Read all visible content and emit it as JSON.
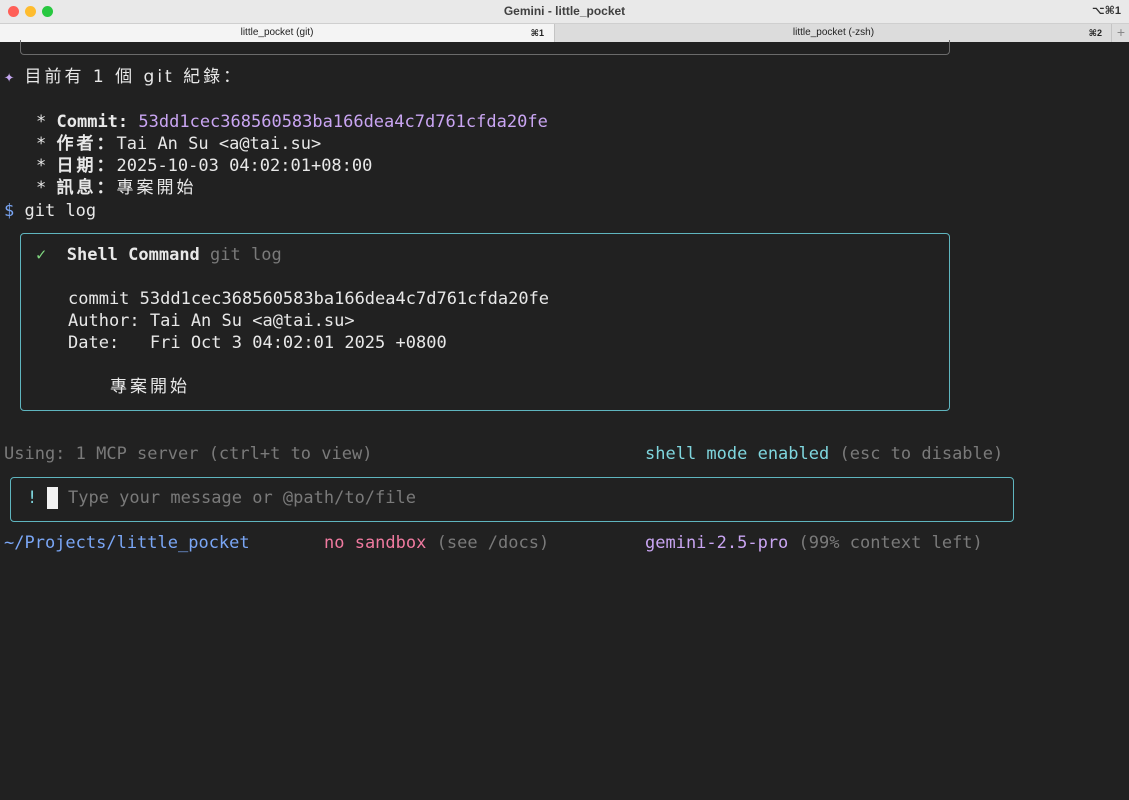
{
  "window": {
    "title": "Gemini - little_pocket",
    "shortcut": "⌥⌘1",
    "traffic_lights": [
      "#ff5f57",
      "#febc2e",
      "#28c840"
    ]
  },
  "tabs": [
    {
      "label": "little_pocket (git)",
      "shortcut": "⌘1",
      "active": true
    },
    {
      "label": "little_pocket (-zsh)",
      "shortcut": "⌘2",
      "active": false
    }
  ],
  "new_tab": "+",
  "response": {
    "star": "✦",
    "heading": "目前有 1 個 git 紀錄：",
    "bullet": "*",
    "items": [
      {
        "label": "Commit:",
        "value": "53dd1cec368560583ba166dea4c7d761cfda20fe"
      },
      {
        "label": "作者：",
        "value": "Tai An Su <a@tai.su>"
      },
      {
        "label": "日期：",
        "value": "2025-10-03 04:02:01+08:00"
      },
      {
        "label": "訊息：",
        "value": "專案開始"
      }
    ]
  },
  "prompt_line": {
    "symbol": "$",
    "command": "git log"
  },
  "shell_box": {
    "check": "✓",
    "title": "Shell Command",
    "command": "git log",
    "output": [
      "commit 53dd1cec368560583ba166dea4c7d761cfda20fe",
      "Author: Tai An Su <a@tai.su>",
      "Date:   Fri Oct 3 04:02:01 2025 +0800"
    ],
    "message": "專案開始"
  },
  "status": {
    "mcp": "Using: 1 MCP server (ctrl+t to view)",
    "shell_mode": "shell mode enabled",
    "shell_mode_hint": "(esc to disable)"
  },
  "input": {
    "prefix": "!",
    "placeholder": "Type your message or @path/to/file"
  },
  "footer": {
    "path": "~/Projects/little_pocket",
    "sandbox": "no sandbox",
    "sandbox_hint": "(see /docs)",
    "model": "gemini-2.5-pro",
    "context": "(99% context left)"
  }
}
